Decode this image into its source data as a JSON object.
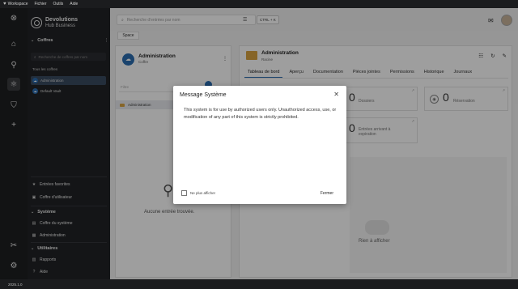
{
  "titlebar": {
    "app": "Workspace",
    "menus": [
      "Fichier",
      "Outils",
      "Aide"
    ]
  },
  "brand": {
    "line1": "Devolutions",
    "line2": "Hub Business"
  },
  "sidebar": {
    "vaults_header": "Coffres",
    "vault_search_placeholder": "Recherche de coffres par nom",
    "all_vaults_label": "Tous les coffres",
    "vaults": [
      {
        "label": "Administration",
        "selected": true
      },
      {
        "label": "Default Vault",
        "selected": false
      }
    ],
    "favorites": "Entrées favorites",
    "user_vault": "Coffre d'utilisateur",
    "system_header": "Système",
    "system_items": [
      "Coffre du système",
      "Administration"
    ],
    "utilities_header": "Utilitaires",
    "utility_items": [
      "Rapports",
      "Aide"
    ]
  },
  "topbar": {
    "search_placeholder": "Recherche d'entrées par nom",
    "shortcut": "CTRL + K",
    "space_tab": "Space"
  },
  "left_panel": {
    "vault_name": "Administration",
    "vault_type": "Coffre",
    "filter_placeholder": "Filtre",
    "tree_item": "Administration",
    "empty_text": "Aucune entrée trouvée."
  },
  "right_panel": {
    "title": "Administration",
    "subtitle": "Racine",
    "tabs": [
      "Tableau de bord",
      "Aperçu",
      "Documentation",
      "Pièces jointes",
      "Permissions",
      "Historique",
      "Journaux"
    ],
    "active_tab": 0,
    "stats": [
      {
        "value": "0",
        "label": "Dossiers"
      },
      {
        "value": "0",
        "label": "Réservation"
      },
      {
        "value": "0",
        "label": "Entrées arrivant à expiration"
      }
    ],
    "nothing_text": "Rien à afficher"
  },
  "status": {
    "version": "2025.1.0"
  },
  "modal": {
    "title": "Message Système",
    "body": "This system is for use by authorized users only. Unauthorized access, use, or modification of any part of this system is strictly prohibited.",
    "checkbox_label": "Ne plus afficher",
    "close_button": "Fermer"
  },
  "colors": {
    "accent": "#2b6cb0",
    "sidebar_bg": "#212326",
    "folder": "#d9a441"
  }
}
